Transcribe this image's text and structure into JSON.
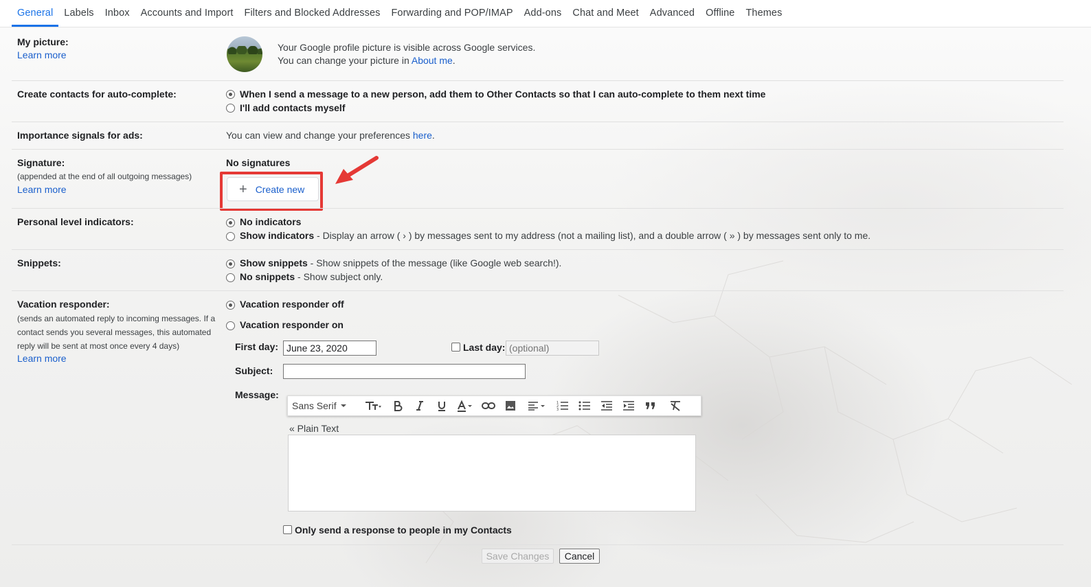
{
  "tabs": [
    {
      "label": "General",
      "active": true
    },
    {
      "label": "Labels"
    },
    {
      "label": "Inbox"
    },
    {
      "label": "Accounts and Import"
    },
    {
      "label": "Filters and Blocked Addresses"
    },
    {
      "label": "Forwarding and POP/IMAP"
    },
    {
      "label": "Add-ons"
    },
    {
      "label": "Chat and Meet"
    },
    {
      "label": "Advanced"
    },
    {
      "label": "Offline"
    },
    {
      "label": "Themes"
    }
  ],
  "picture": {
    "label": "My picture:",
    "learn_more": "Learn more",
    "line1": "Your Google profile picture is visible across Google services.",
    "line2_prefix": "You can change your picture in ",
    "line2_link": "About me",
    "line2_suffix": "."
  },
  "autocomplete": {
    "label": "Create contacts for auto-complete:",
    "option1": "When I send a message to a new person, add them to Other Contacts so that I can auto-complete to them next time",
    "option2": "I'll add contacts myself"
  },
  "ads": {
    "label": "Importance signals for ads:",
    "text_prefix": "You can view and change your preferences ",
    "link": "here",
    "text_suffix": "."
  },
  "signature": {
    "label": "Signature:",
    "sublabel": "(appended at the end of all outgoing messages)",
    "learn_more": "Learn more",
    "status": "No signatures",
    "create_new": "Create new"
  },
  "personal_level": {
    "label": "Personal level indicators:",
    "option1": "No indicators",
    "option2_bold": "Show indicators",
    "option2_text": " - Display an arrow ( › ) by messages sent to my address (not a mailing list), and a double arrow ( » ) by messages sent only to me."
  },
  "snippets": {
    "label": "Snippets:",
    "option1_bold": "Show snippets",
    "option1_text": " - Show snippets of the message (like Google web search!).",
    "option2_bold": "No snippets",
    "option2_text": " - Show subject only."
  },
  "vacation": {
    "label": "Vacation responder:",
    "sublabel_lines": [
      "(sends an automated reply to incoming messages. If a",
      "contact sends you several messages, this automated",
      "reply will be sent at most once every 4 days)"
    ],
    "learn_more": "Learn more",
    "off": "Vacation responder off",
    "on": "Vacation responder on",
    "first_day_label": "First day:",
    "first_day_value": "June 23, 2020",
    "last_day_label": "Last day:",
    "last_day_placeholder": "(optional)",
    "subject_label": "Subject:",
    "subject_value": "",
    "message_label": "Message:",
    "font": "Sans Serif",
    "plain_text": "« Plain Text",
    "contacts_only": "Only send a response to people in my Contacts"
  },
  "actions": {
    "save": "Save Changes",
    "cancel": "Cancel"
  },
  "colors": {
    "accent": "#1a73e8",
    "link": "#1a5fcc",
    "highlight": "#e53935"
  }
}
